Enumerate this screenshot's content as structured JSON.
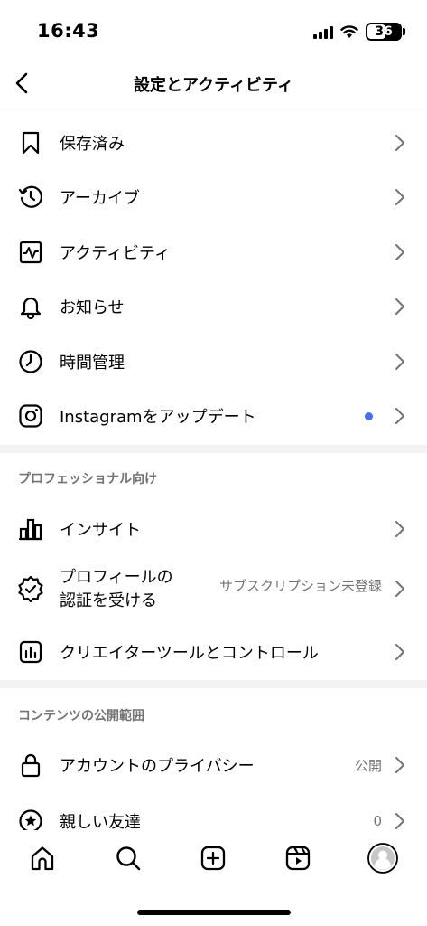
{
  "status_bar": {
    "time": "16:43",
    "battery": "36"
  },
  "header": {
    "title": "設定とアクティビティ"
  },
  "items": [
    {
      "label": "保存済み"
    },
    {
      "label": "アーカイブ"
    },
    {
      "label": "アクティビティ"
    },
    {
      "label": "お知らせ"
    },
    {
      "label": "時間管理"
    },
    {
      "label": "Instagramをアップデート"
    }
  ],
  "professional": {
    "header": "プロフェッショナル向け",
    "insights": "インサイト",
    "verification_line1": "プロフィールの",
    "verification_line2": "認証を受ける",
    "verification_status": "サブスクリプション未登録",
    "creator_tools": "クリエイターツールとコントロール"
  },
  "content": {
    "header": "コンテンツの公開範囲",
    "privacy_label": "アカウントのプライバシー",
    "privacy_value": "公開",
    "close_friends_label": "親しい友達",
    "close_friends_value": "0"
  },
  "colors": {
    "accent_dot": "#4b6cf0",
    "muted_text": "#737373",
    "section_bg": "#f3f3f3"
  }
}
